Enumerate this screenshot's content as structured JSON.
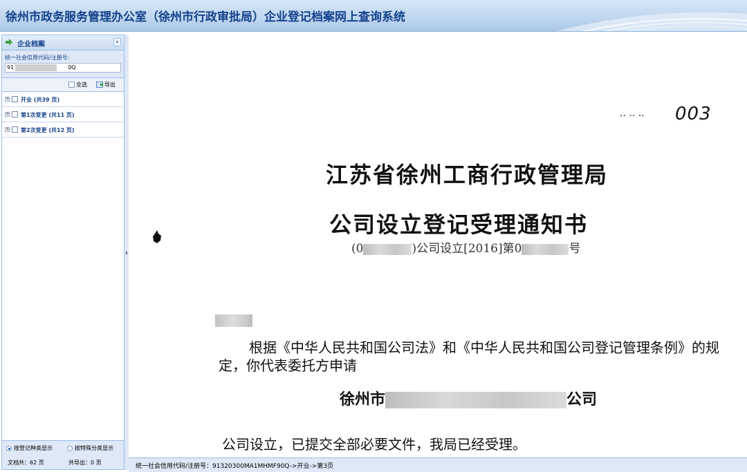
{
  "header": {
    "title": "徐州市政务服务管理办公室（徐州市行政审批局）企业登记档案网上查询系统"
  },
  "left_panel": {
    "title": "企业档案",
    "collapse_label": "«",
    "search": {
      "label": "统一社会信用代码/注册号:",
      "value_prefix": "91",
      "value_suffix": "0Q"
    },
    "toolbar": {
      "select_all": "全选",
      "export": "导出"
    },
    "tree": [
      {
        "label": "开业 (共39 页)"
      },
      {
        "label": "第1次变更 (共11 页)"
      },
      {
        "label": "第2次变更 (共12 页)"
      }
    ],
    "radios": {
      "by_type": "按登记种类显示",
      "by_special": "按特殊分类显示"
    },
    "stats": {
      "total": "文档共：62 页",
      "exported": "共导出：0 页"
    }
  },
  "document": {
    "page_marker": "003",
    "page_dots": "·· ·· ··",
    "title1": "江苏省徐州工商行政管理局",
    "title2": "公司设立登记受理通知书",
    "ref_open": "(0",
    "ref_mid": ")公司设立[2016]第0",
    "ref_end": "号",
    "paragraph": "根据《中华人民共和国公司法》和《中华人民共和国公司登记管理条例》的规定，你代表委托方申请",
    "company_prefix": "徐州市",
    "company_suffix": "公司",
    "accept_line": "公司设立，已提交全部必要文件，我局已经受理。"
  },
  "status_bar": {
    "text": "统一社会信用代码/注册号：91320300MA1MHMF90Q->开业->第3页"
  }
}
